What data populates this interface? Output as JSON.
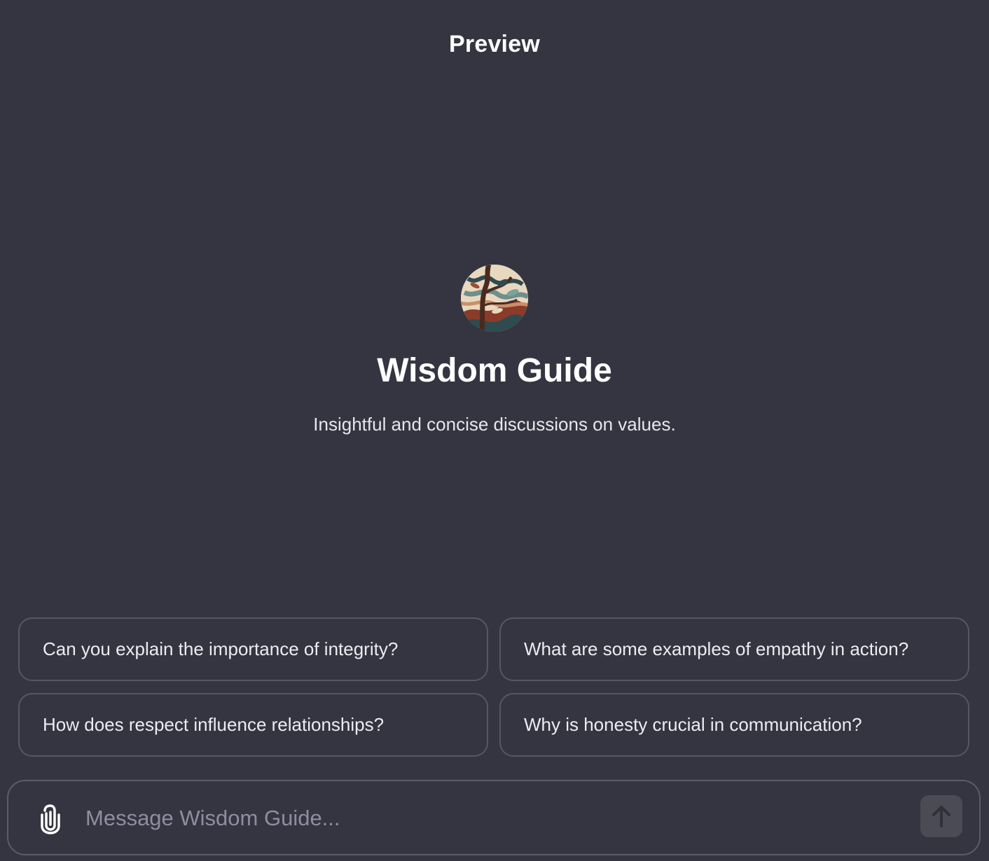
{
  "header": {
    "title": "Preview"
  },
  "gpt": {
    "name": "Wisdom Guide",
    "description": "Insightful and concise discussions on values.",
    "avatar_icon": "abstract-tree-avatar"
  },
  "suggestions": [
    {
      "label": "Can you explain the importance of integrity?"
    },
    {
      "label": "What are some examples of empathy in action?"
    },
    {
      "label": "How does respect influence relationships?"
    },
    {
      "label": "Why is honesty crucial in communication?"
    }
  ],
  "composer": {
    "placeholder": "Message Wisdom Guide...",
    "value": "",
    "attach_icon": "paperclip-icon",
    "send_icon": "arrow-up-icon"
  },
  "colors": {
    "background": "#343541",
    "border": "#56575f",
    "text": "#ececf1",
    "placeholder": "#8e8ea0",
    "send_button": "#4a4b54"
  }
}
